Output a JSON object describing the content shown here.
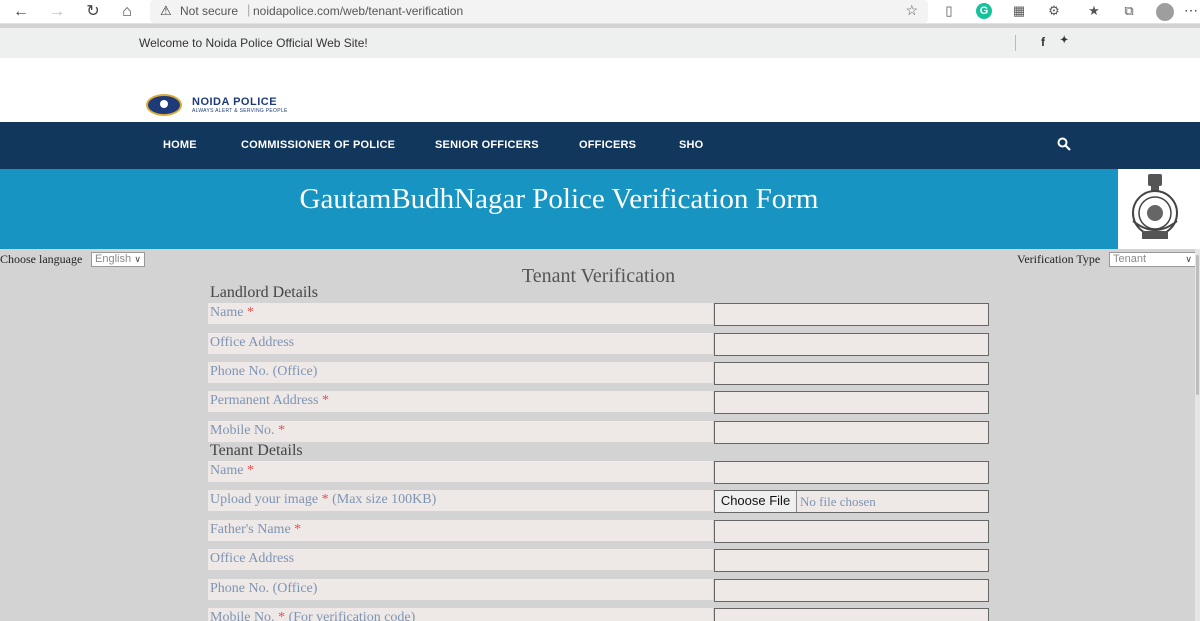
{
  "browser": {
    "security": "Not secure",
    "url": "noidapolice.com/web/tenant-verification"
  },
  "topbar": {
    "welcome": "Welcome to Noida Police Official Web Site!",
    "facebook": "f",
    "twitter": "🐦"
  },
  "logo": {
    "name": "NOIDA POLICE",
    "tagline": "ALWAYS ALERT & SERVING PEOPLE"
  },
  "nav": {
    "items": [
      {
        "label": "HOME"
      },
      {
        "label": "COMMISSIONER OF POLICE"
      },
      {
        "label": "SENIOR OFFICERS"
      },
      {
        "label": "OFFICERS"
      },
      {
        "label": "SHO"
      }
    ]
  },
  "banner": {
    "title": "GautamBudhNagar Police Verification Form"
  },
  "controls": {
    "language_label": "Choose language",
    "language_value": "English",
    "verification_label": "Verification Type",
    "verification_value": "Tenant"
  },
  "form": {
    "title": "Tenant Verification",
    "landlord_title": "Landlord Details",
    "tenant_title": "Tenant Details",
    "required_mark": "*",
    "landlord_fields": [
      {
        "label": "Name",
        "required": true
      },
      {
        "label": "Office Address",
        "required": false
      },
      {
        "label": "Phone No. (Office)",
        "required": false
      },
      {
        "label": "Permanent Address",
        "required": true
      },
      {
        "label": "Mobile No.",
        "required": true
      }
    ],
    "tenant_fields": [
      {
        "label": "Name",
        "required": true
      },
      {
        "label": "Upload your image",
        "required": true,
        "suffix": "(Max size 100KB)"
      },
      {
        "label": "Father's Name",
        "required": true
      },
      {
        "label": "Office Address",
        "required": false
      },
      {
        "label": "Phone No. (Office)",
        "required": false
      },
      {
        "label": "Mobile No.",
        "required": true,
        "suffix": "(For verification code)"
      }
    ],
    "file_button": "Choose File",
    "file_status": "No file chosen"
  },
  "colors": {
    "nav_bg": "#11375c",
    "banner_bg": "#1894c2",
    "label_color": "#7d95b3",
    "required_color": "#d9534f"
  }
}
